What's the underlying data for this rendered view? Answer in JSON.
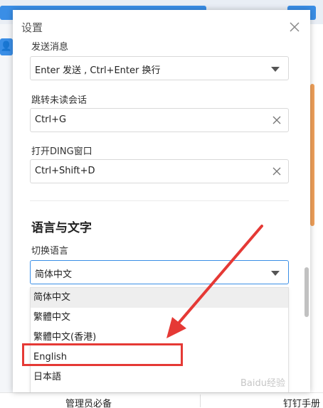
{
  "background": {
    "avatar_glyph": "👤",
    "bottom_left": "管理员必备",
    "bottom_right": "钉钉手册"
  },
  "dialog": {
    "title": "设置",
    "send_message": {
      "label": "发送消息",
      "value": "Enter 发送 , Ctrl+Enter 换行"
    },
    "jump_unread": {
      "label": "跳转未读会话",
      "value": "Ctrl+G"
    },
    "open_ding": {
      "label": "打开DING窗口",
      "value": "Ctrl+Shift+D"
    },
    "language_section": {
      "title": "语言与文字",
      "switch_label": "切换语言",
      "selected": "简体中文",
      "options": [
        "简体中文",
        "繁體中文",
        "繁體中文(香港)",
        "English",
        "日本語"
      ]
    }
  },
  "watermark": "Baidu经验",
  "colors": {
    "accent": "#3a8ee6",
    "annotation": "#e53935",
    "scroll_accent": "#f0a15a"
  }
}
